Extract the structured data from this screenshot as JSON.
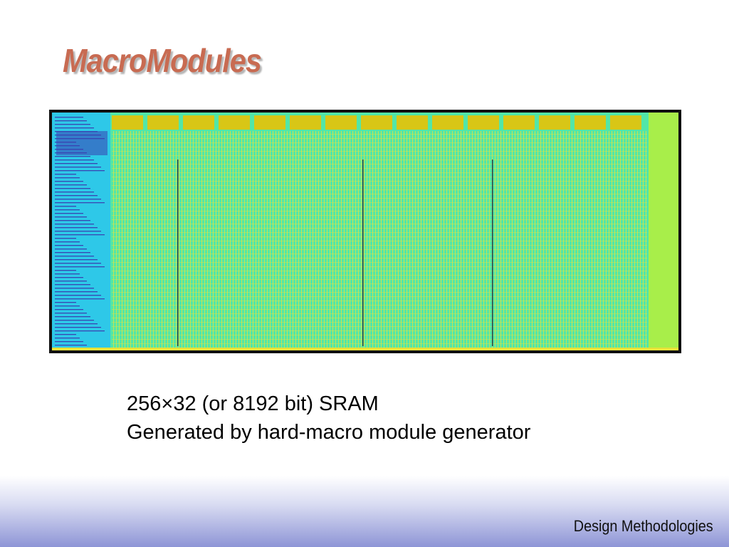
{
  "slide": {
    "title": "MacroModules",
    "caption_lines": [
      "256×32 (or 8192 bit) SRAM",
      "Generated by hard-macro module generator"
    ],
    "footer": "Design Methodologies"
  },
  "figure": {
    "subject": "SRAM layout plot",
    "colors": {
      "array": "#52e6a8",
      "column_lines": "#e8e33a",
      "header_blocks": "#d8c616",
      "decoder": "#2ec8e8",
      "decoder_lines": "#3a3fb0",
      "right_strip": "#a8ee4a",
      "border": "#101010"
    }
  }
}
